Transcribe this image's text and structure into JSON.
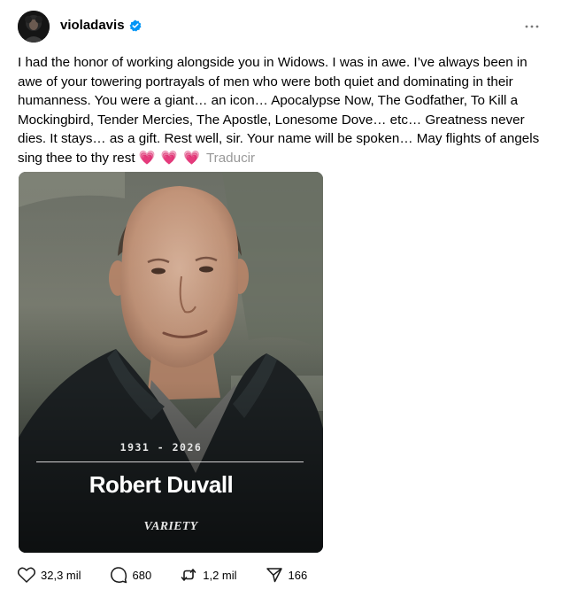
{
  "author": {
    "username": "violadavis",
    "verified": true
  },
  "post": {
    "text": "I had the honor of working alongside you in Widows. I was in awe. I’ve always been in awe of your towering portrayals of men who were both quiet and dominating in their humanness. You were a giant… an icon… Apocalypse Now, The Godfather, To Kill a Mockingbird, Tender Mercies, The Apostle, Lonesome Dove… etc… Greatness never dies. It stays… as a gift. Rest well, sir. Your name will be spoken… May flights of angels sing thee to thy rest",
    "emoji": "💗 💗 💗",
    "translate_label": "Traducir"
  },
  "media": {
    "years": "1931 - 2026",
    "name": "Robert Duvall",
    "brand": "VARIETY"
  },
  "actions": {
    "likes": "32,3 mil",
    "comments": "680",
    "reposts": "1,2 mil",
    "shares": "166"
  },
  "icons": {
    "verified": "verified-badge-icon",
    "more": "more-options-icon",
    "like": "heart-icon",
    "comment": "comment-icon",
    "repost": "repost-icon",
    "share": "share-icon"
  },
  "colors": {
    "verified": "#0095f6",
    "hearts": "#e8275b",
    "muted": "#999999"
  }
}
